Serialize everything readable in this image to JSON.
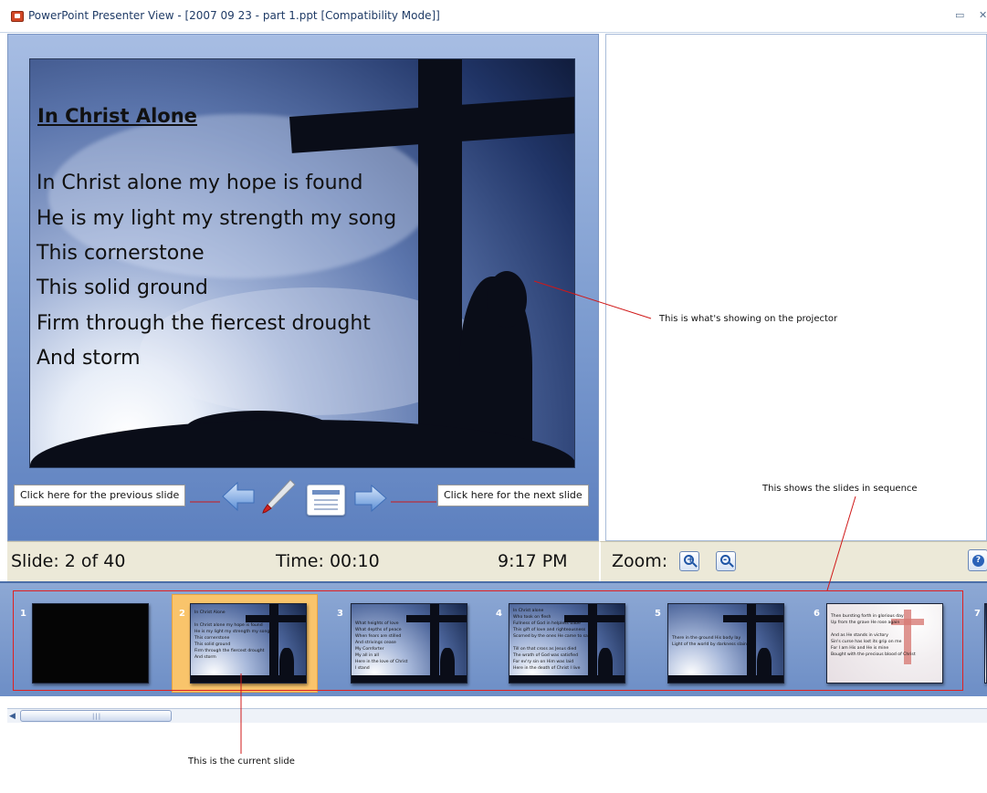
{
  "window": {
    "title": "PowerPoint Presenter View - [2007 09 23 - part 1.ppt [Compatibility Mode]]",
    "restore_glyph": "▭",
    "close_glyph": "✕"
  },
  "slide": {
    "title": "In Christ Alone",
    "lines": [
      "In Christ alone my hope is found",
      "He is my light my strength my song",
      "This cornerstone",
      "This solid ground",
      "Firm through the fiercest drought",
      "And storm"
    ]
  },
  "nav": {
    "previous_callout": "Click here for the previous slide",
    "next_callout": "Click here for the next slide",
    "icons": [
      "left-arrow-icon",
      "pen-icon",
      "notes-icon",
      "right-arrow-icon"
    ]
  },
  "status": {
    "slide_counter": "Slide: 2 of 40",
    "time": "Time: 00:10",
    "clock": "9:17 PM",
    "zoom_label": "Zoom:",
    "help_glyph": "?"
  },
  "filmstrip": {
    "selected_index": 2,
    "thumbs": [
      {
        "number": "1",
        "text": ""
      },
      {
        "number": "2",
        "text": "In Christ Alone\n\nIn Christ alone my hope is found\nHe is my light my strength my song\nThis cornerstone\nThis solid ground\nFirm through the fiercest drought\nAnd storm"
      },
      {
        "number": "3",
        "text": "What heights of love\nWhat depths of peace\nWhen fears are stilled\nAnd strivings cease\nMy Comforter\nMy all in all\nHere in the love of Christ\nI stand"
      },
      {
        "number": "4",
        "text": "In Christ alone\nWho took on flesh\nFullness of God in helpless babe\nThis gift of love and righteousness\nScorned by the ones He came to save\n\nTill on that cross as Jesus died\nThe wrath of God was satisfied\nFor ev'ry sin on Him was laid\nHere in the death of Christ I live"
      },
      {
        "number": "5",
        "text": "There in the ground His body lay\nLight of the world by darkness slain"
      },
      {
        "number": "6",
        "text": "Then bursting forth in glorious day\nUp from the grave He rose again\n\nAnd as He stands in victory\nSin's curse has lost its grip on me\nFor I am His and He is mine\nBought with the precious blood of Christ"
      },
      {
        "number": "7",
        "text": ""
      }
    ]
  },
  "annotations": {
    "projector": "This is what's showing on the projector",
    "sequence": "This shows the slides in sequence",
    "current": "This is the current slide"
  },
  "colors": {
    "annotation_line": "#d01818",
    "selected_thumb": "#f9c46b",
    "pane_gradient_top": "#a7bde3",
    "pane_gradient_bottom": "#5d80bf"
  }
}
